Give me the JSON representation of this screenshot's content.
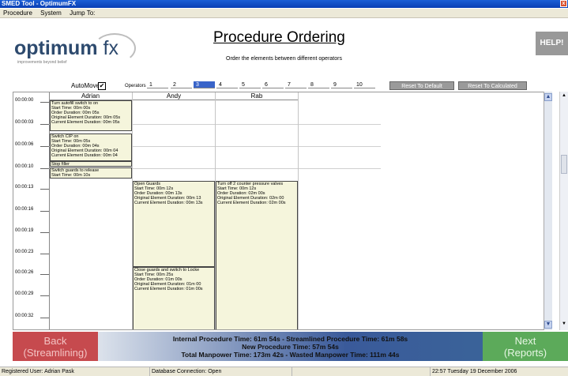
{
  "window": {
    "title": "SMED Tool - OptimumFX",
    "close_glyph": "x"
  },
  "menu": [
    "Procedure",
    "System",
    "Jump To:"
  ],
  "logo": {
    "brand_main": "optimum",
    "brand_fx": " fx",
    "tagline": "improvements beyond belief"
  },
  "page": {
    "title": "Procedure Ordering",
    "subtitle": "Order the elements between different operators"
  },
  "help_label": "HELP!",
  "toolbar": {
    "automove_label": "AutoMove",
    "automove_checked": "✔",
    "operators_label": "Operators",
    "operators": [
      "1",
      "2",
      "3",
      "4",
      "5",
      "6",
      "7",
      "8",
      "9",
      "10"
    ],
    "selected_operator": "3",
    "reset_default_label": "Reset To Default",
    "reset_calculated_label": "Reset To Calculated"
  },
  "columns": [
    "Adrian",
    "Andy",
    "Rab"
  ],
  "times": [
    "00:00:00",
    "00:00:03",
    "00:00:06",
    "00:00:10",
    "00:00:13",
    "00:00:16",
    "00:00:19",
    "00:00:23",
    "00:00:26",
    "00:00:29",
    "00:00:32"
  ],
  "blocks": {
    "adrian_1": [
      "Turn autofill switch to on",
      "Start Time: 00m 00s",
      "Order Duration: 00m 05s",
      "Original Element Duration: 00m 05s",
      "Current Element Duration: 00m 05s"
    ],
    "adrian_2": [
      "Switch CIP on",
      "Start Time: 00m 05s",
      "Order Duration: 00m 04s",
      "Original Element Duration: 00m 04",
      "Current Element Duration: 00m 04"
    ],
    "adrian_3": [
      "Stop filler"
    ],
    "adrian_4": [
      "Switch guards to release",
      "Start Time: 00m 10s"
    ],
    "andy_1": [
      "Open Guards",
      "Start Time: 00m 12s",
      "Order Duration: 00m 13s",
      "Original Element Duration: 00m 13",
      "Current Element Duration: 00m 13s"
    ],
    "andy_2": [
      "Close guards and switch to Locke",
      "Start Time: 00m 25s",
      "Order Duration: 01m 00s",
      "Original Element Duration: 01m 00",
      "Current Element Duration: 01m 00s"
    ],
    "rab_1": [
      "Turn off 2 counter pressure valves",
      "Start Time: 00m 12s",
      "Order Duration: 02m 00s",
      "Original Element Duration: 02m 00",
      "Current Element Duration: 02m 00s"
    ]
  },
  "footer": {
    "back": {
      "line1": "Back",
      "line2": "(Streamlining)"
    },
    "next": {
      "line1": "Next",
      "line2": "(Reports)"
    },
    "line1": "Internal Procedure Time: 61m 54s  -  Streamlined Procedure Time: 61m 58s",
    "line2": "New Procedure Time: 57m 54s",
    "line3": "Total Manpower Time: 173m 42s  -  Wasted Manpower Time: 111m 44s"
  },
  "status": {
    "user": "Registered User: Adrian Pask",
    "db": "Database Connection: Open",
    "datetime": "22:57 Tuesday 19 December 2006"
  },
  "colors": {
    "accent": "#3964c9",
    "back": "#c64a4e",
    "next": "#5caa5a",
    "block": "#f5f5dc"
  }
}
